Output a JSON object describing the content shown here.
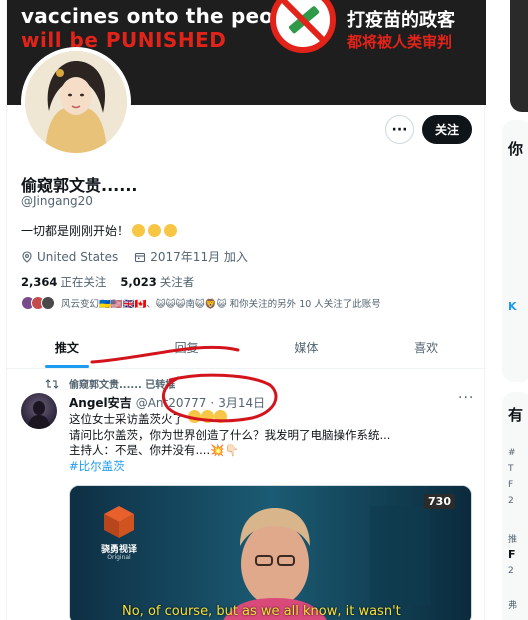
{
  "banner": {
    "line1": "vaccines onto the people",
    "line2": "will be PUNISHED",
    "cn_line1": "打疫苗的政客",
    "cn_line2": "都将被人类审判"
  },
  "profile": {
    "display_name": "偷窥郭文贵......",
    "handle": "@Jingang20",
    "bio": "一切都是刚刚开始！",
    "location": "United States",
    "joined": "2017年11月 加入",
    "following_count": "2,364",
    "following_label": "正在关注",
    "followers_count": "5,023",
    "followers_label": "关注者",
    "known_followers_text": "风云变幻🇺🇦🇺🇸🇬🇧🇨🇦、😺😺😺南😺🦁😺 和你关注的另外 10 人关注了此账号"
  },
  "actions": {
    "more_label": "···",
    "follow_label": "关注"
  },
  "tabs": [
    {
      "label": "推文",
      "active": true
    },
    {
      "label": "回复",
      "active": false
    },
    {
      "label": "媒体",
      "active": false
    },
    {
      "label": "喜欢",
      "active": false
    }
  ],
  "tweet": {
    "retweet_by": "偷窥郭文贵...... 已转推",
    "author_name": "Angel安吉",
    "author_handle": "@Ant20777",
    "date": "3月14日",
    "lines": [
      "这位女士采访盖茨火了",
      "请问比尔盖茨，你为世界创造了什么？我发明了电脑操作系统...",
      "主持人：不是、你并没有....💥👇🏻"
    ],
    "hashtag": "#比尔盖茨",
    "media": {
      "logo_text": "骁勇视译",
      "logo_sub": "Original",
      "channel_number": "730",
      "subtitle": "No, of course, but as we all know, it wasn't"
    }
  },
  "right_sidebar": {
    "heading_a": "你",
    "heading_b": "有",
    "bits": [
      "K",
      "#",
      "T",
      "F",
      "2",
      "推",
      "F",
      "2",
      "弗"
    ]
  },
  "colors": {
    "accent": "#1d9bf0",
    "annotation": "#d4141c",
    "text": "#0f1419",
    "muted": "#536471"
  }
}
